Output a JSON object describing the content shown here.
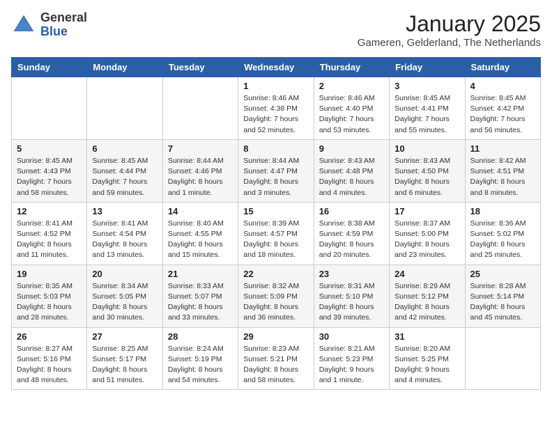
{
  "header": {
    "logo": {
      "line1": "General",
      "line2": "Blue"
    },
    "title": "January 2025",
    "subtitle": "Gameren, Gelderland, The Netherlands"
  },
  "columns": [
    "Sunday",
    "Monday",
    "Tuesday",
    "Wednesday",
    "Thursday",
    "Friday",
    "Saturday"
  ],
  "weeks": [
    [
      {
        "day": "",
        "info": ""
      },
      {
        "day": "",
        "info": ""
      },
      {
        "day": "",
        "info": ""
      },
      {
        "day": "1",
        "info": "Sunrise: 8:46 AM\nSunset: 4:38 PM\nDaylight: 7 hours and 52 minutes."
      },
      {
        "day": "2",
        "info": "Sunrise: 8:46 AM\nSunset: 4:40 PM\nDaylight: 7 hours and 53 minutes."
      },
      {
        "day": "3",
        "info": "Sunrise: 8:45 AM\nSunset: 4:41 PM\nDaylight: 7 hours and 55 minutes."
      },
      {
        "day": "4",
        "info": "Sunrise: 8:45 AM\nSunset: 4:42 PM\nDaylight: 7 hours and 56 minutes."
      }
    ],
    [
      {
        "day": "5",
        "info": "Sunrise: 8:45 AM\nSunset: 4:43 PM\nDaylight: 7 hours and 58 minutes."
      },
      {
        "day": "6",
        "info": "Sunrise: 8:45 AM\nSunset: 4:44 PM\nDaylight: 7 hours and 59 minutes."
      },
      {
        "day": "7",
        "info": "Sunrise: 8:44 AM\nSunset: 4:46 PM\nDaylight: 8 hours and 1 minute."
      },
      {
        "day": "8",
        "info": "Sunrise: 8:44 AM\nSunset: 4:47 PM\nDaylight: 8 hours and 3 minutes."
      },
      {
        "day": "9",
        "info": "Sunrise: 8:43 AM\nSunset: 4:48 PM\nDaylight: 8 hours and 4 minutes."
      },
      {
        "day": "10",
        "info": "Sunrise: 8:43 AM\nSunset: 4:50 PM\nDaylight: 8 hours and 6 minutes."
      },
      {
        "day": "11",
        "info": "Sunrise: 8:42 AM\nSunset: 4:51 PM\nDaylight: 8 hours and 8 minutes."
      }
    ],
    [
      {
        "day": "12",
        "info": "Sunrise: 8:41 AM\nSunset: 4:52 PM\nDaylight: 8 hours and 11 minutes."
      },
      {
        "day": "13",
        "info": "Sunrise: 8:41 AM\nSunset: 4:54 PM\nDaylight: 8 hours and 13 minutes."
      },
      {
        "day": "14",
        "info": "Sunrise: 8:40 AM\nSunset: 4:55 PM\nDaylight: 8 hours and 15 minutes."
      },
      {
        "day": "15",
        "info": "Sunrise: 8:39 AM\nSunset: 4:57 PM\nDaylight: 8 hours and 18 minutes."
      },
      {
        "day": "16",
        "info": "Sunrise: 8:38 AM\nSunset: 4:59 PM\nDaylight: 8 hours and 20 minutes."
      },
      {
        "day": "17",
        "info": "Sunrise: 8:37 AM\nSunset: 5:00 PM\nDaylight: 8 hours and 23 minutes."
      },
      {
        "day": "18",
        "info": "Sunrise: 8:36 AM\nSunset: 5:02 PM\nDaylight: 8 hours and 25 minutes."
      }
    ],
    [
      {
        "day": "19",
        "info": "Sunrise: 8:35 AM\nSunset: 5:03 PM\nDaylight: 8 hours and 28 minutes."
      },
      {
        "day": "20",
        "info": "Sunrise: 8:34 AM\nSunset: 5:05 PM\nDaylight: 8 hours and 30 minutes."
      },
      {
        "day": "21",
        "info": "Sunrise: 8:33 AM\nSunset: 5:07 PM\nDaylight: 8 hours and 33 minutes."
      },
      {
        "day": "22",
        "info": "Sunrise: 8:32 AM\nSunset: 5:09 PM\nDaylight: 8 hours and 36 minutes."
      },
      {
        "day": "23",
        "info": "Sunrise: 8:31 AM\nSunset: 5:10 PM\nDaylight: 8 hours and 39 minutes."
      },
      {
        "day": "24",
        "info": "Sunrise: 8:29 AM\nSunset: 5:12 PM\nDaylight: 8 hours and 42 minutes."
      },
      {
        "day": "25",
        "info": "Sunrise: 8:28 AM\nSunset: 5:14 PM\nDaylight: 8 hours and 45 minutes."
      }
    ],
    [
      {
        "day": "26",
        "info": "Sunrise: 8:27 AM\nSunset: 5:16 PM\nDaylight: 8 hours and 48 minutes."
      },
      {
        "day": "27",
        "info": "Sunrise: 8:25 AM\nSunset: 5:17 PM\nDaylight: 8 hours and 51 minutes."
      },
      {
        "day": "28",
        "info": "Sunrise: 8:24 AM\nSunset: 5:19 PM\nDaylight: 8 hours and 54 minutes."
      },
      {
        "day": "29",
        "info": "Sunrise: 8:23 AM\nSunset: 5:21 PM\nDaylight: 8 hours and 58 minutes."
      },
      {
        "day": "30",
        "info": "Sunrise: 8:21 AM\nSunset: 5:23 PM\nDaylight: 9 hours and 1 minute."
      },
      {
        "day": "31",
        "info": "Sunrise: 8:20 AM\nSunset: 5:25 PM\nDaylight: 9 hours and 4 minutes."
      },
      {
        "day": "",
        "info": ""
      }
    ]
  ]
}
